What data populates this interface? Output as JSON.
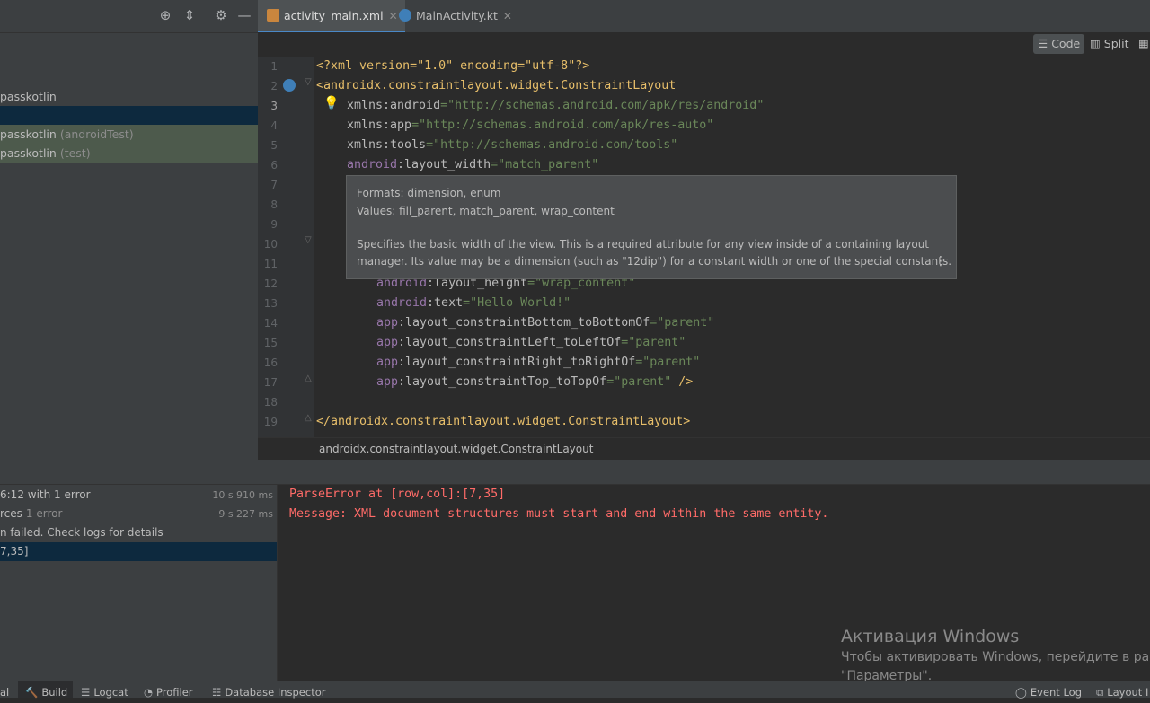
{
  "project_tree": {
    "items": [
      {
        "label": "passkotlin",
        "suffix": ""
      },
      {
        "label": "",
        "suffix": ""
      },
      {
        "label": "passkotlin",
        "suffix": "(androidTest)"
      },
      {
        "label": "passkotlin",
        "suffix": "(test)"
      }
    ]
  },
  "editor_tabs": [
    {
      "label": "activity_main.xml",
      "active": true
    },
    {
      "label": "MainActivity.kt",
      "active": false
    }
  ],
  "view_modes": {
    "code": "Code",
    "split": "Split"
  },
  "line_numbers": [
    "1",
    "2",
    "3",
    "4",
    "5",
    "6",
    "7",
    "8",
    "9",
    "10",
    "11",
    "12",
    "13",
    "14",
    "15",
    "16",
    "17",
    "18",
    "19"
  ],
  "code_lines": {
    "l1_pi": "<?xml version=\"1.0\" encoding=\"utf-8\"?>",
    "l2_tag": "<androidx.constraintlayout.widget.ConstraintLayout",
    "l3_ns": "xmlns:android",
    "l3_val": "=\"http://schemas.android.com/apk/res/android\"",
    "l4_ns": "xmlns:app",
    "l4_val": "=\"http://schemas.android.com/apk/res-auto\"",
    "l5_ns": "xmlns:tools",
    "l5_val": "=\"http://schemas.android.com/tools\"",
    "l6_ns": "android",
    "l6_attr": ":layout_width",
    "l6_val": "=\"match_parent\"",
    "l12_ns": "android",
    "l12_attr": ":layout_height",
    "l12_val": "=\"wrap_content\"",
    "l13_ns": "android",
    "l13_attr": ":text",
    "l13_val": "=\"Hello World!\"",
    "l14_ns": "app",
    "l14_attr": ":layout_constraintBottom_toBottomOf",
    "l14_val": "=\"parent\"",
    "l15_ns": "app",
    "l15_attr": ":layout_constraintLeft_toLeftOf",
    "l15_val": "=\"parent\"",
    "l16_ns": "app",
    "l16_attr": ":layout_constraintRight_toRightOf",
    "l16_val": "=\"parent\"",
    "l17_ns": "app",
    "l17_attr": ":layout_constraintTop_toTopOf",
    "l17_val": "=\"parent\"",
    "l17_end": " />",
    "l19_tag": "</androidx.constraintlayout.widget.ConstraintLayout>"
  },
  "tooltip": {
    "formats": "Formats: dimension, enum",
    "values": "Values: fill_parent, match_parent, wrap_content",
    "desc_1": "Specifies the basic width of the view. This is a required attribute for any view inside of a containing layout",
    "desc_2": "manager. Its value may be a dimension (such as \"12dip\") for a constant width or one of the special constants."
  },
  "breadcrumb": "androidx.constraintlayout.widget.ConstraintLayout",
  "build_tree": [
    {
      "label": "6:12 with 1 error",
      "suffix": "",
      "time": "10 s 910 ms"
    },
    {
      "label": "rces",
      "suffix": "1 error",
      "time": "9 s 227 ms"
    },
    {
      "label": "n failed. Check logs for details",
      "suffix": "",
      "time": ""
    },
    {
      "label": "7,35]",
      "suffix": "",
      "time": ""
    }
  ],
  "build_output": {
    "line1": "ParseError at [row,col]:[7,35]",
    "line2": "Message: XML document structures must start and end within the same entity."
  },
  "watermark": {
    "title": "Активация Windows",
    "line1": "Чтобы активировать Windows, перейдите в разде",
    "line2": "\"Параметры\"."
  },
  "status_bar": {
    "first": "al",
    "build": "Build",
    "logcat": "Logcat",
    "profiler": "Profiler",
    "db_inspector": "Database Inspector",
    "event_log": "Event Log",
    "layout": "Layout I"
  },
  "colors": {
    "accent": "#4a88c7",
    "error": "#ff6b68",
    "xml_tag": "#e8bf6a",
    "xml_value": "#6a8759",
    "xml_namespace": "#9876aa"
  }
}
